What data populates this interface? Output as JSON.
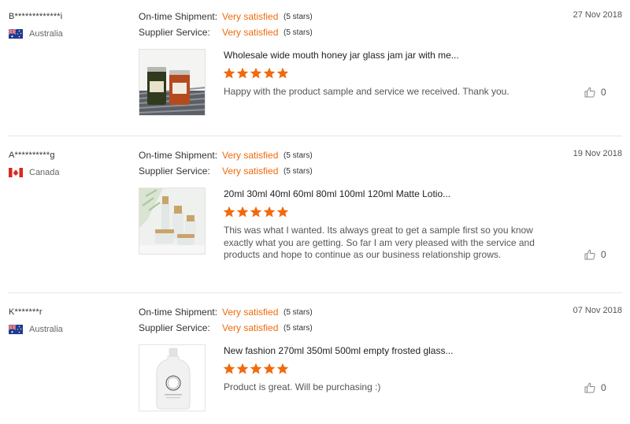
{
  "labels": {
    "ontime": "On-time Shipment:",
    "supplier": "Supplier Service:"
  },
  "colors": {
    "accent": "#f06a0e",
    "star": "#f06a0e",
    "divider": "#e6e6e6"
  },
  "reviews": [
    {
      "buyer": "B*************i",
      "country": "Australia",
      "flag": "flag-australia-icon",
      "date": "27 Nov 2018",
      "ontime_value": "Very satisfied",
      "ontime_stars": "(5 stars)",
      "supplier_value": "Very satisfied",
      "supplier_stars": "(5 stars)",
      "product_title": "Wholesale wide mouth honey jar glass jam jar with me...",
      "product_rating": 5,
      "comment": "Happy with the product sample and service we received. Thank you.",
      "likes": "0"
    },
    {
      "buyer": "A**********g",
      "country": "Canada",
      "flag": "flag-canada-icon",
      "date": "19 Nov 2018",
      "ontime_value": "Very satisfied",
      "ontime_stars": "(5 stars)",
      "supplier_value": "Very satisfied",
      "supplier_stars": "(5 stars)",
      "product_title": "20ml 30ml 40ml 60ml 80ml 100ml 120ml Matte Lotio...",
      "product_rating": 5,
      "comment": "This was what I wanted. Its always great to get a sample first so you know exactly what you are getting.  So far I am very pleased with the service and products and hope to continue as our business relationship grows.",
      "likes": "0"
    },
    {
      "buyer": "K*******r",
      "country": "Australia",
      "flag": "flag-australia-icon",
      "date": "07 Nov 2018",
      "ontime_value": "Very satisfied",
      "ontime_stars": "(5 stars)",
      "supplier_value": "Very satisfied",
      "supplier_stars": "(5 stars)",
      "product_title": "New fashion 270ml 350ml 500ml empty frosted glass...",
      "product_rating": 5,
      "comment": "Product is great. Will be purchasing :)",
      "likes": "0"
    }
  ]
}
